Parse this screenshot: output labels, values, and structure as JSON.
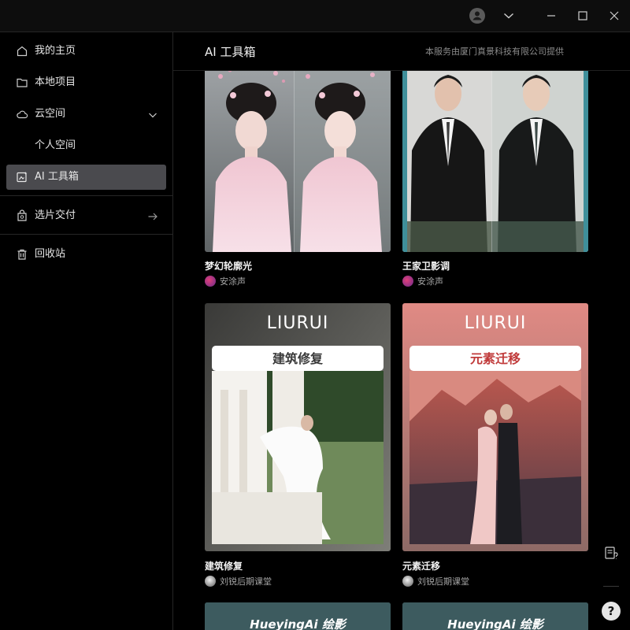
{
  "window": {
    "user_icon": "user-icon",
    "dropdown_icon": "chevron-down-icon",
    "minimize_icon": "minimize-icon",
    "maximize_icon": "maximize-icon",
    "close_icon": "close-icon"
  },
  "sidebar": {
    "items": [
      {
        "label": "我的主页",
        "icon": "home-icon"
      },
      {
        "label": "本地项目",
        "icon": "folder-icon"
      },
      {
        "label": "云空间",
        "icon": "cloud-icon"
      },
      {
        "label": "个人空间",
        "icon": ""
      },
      {
        "label": "AI 工具箱",
        "icon": "ai-toolbox-icon",
        "active": true
      },
      {
        "label": "选片交付",
        "icon": "delivery-icon"
      },
      {
        "label": "回收站",
        "icon": "trash-icon"
      }
    ]
  },
  "main": {
    "title": "AI 工具箱",
    "notice": "本服务由厦门真景科技有限公司提供",
    "cards": [
      {
        "title": "梦幻轮廓光",
        "author": "安涂声"
      },
      {
        "title": "王家卫影调",
        "author": "安涂声"
      },
      {
        "title": "建筑修复",
        "author": "刘锐后期课堂",
        "brand": "LIURUI",
        "banner": "建筑修复"
      },
      {
        "title": "元素迁移",
        "author": "刘锐后期课堂",
        "brand": "LIURUI",
        "banner": "元素迁移"
      },
      {
        "brand": "HueyingAi 绘影"
      },
      {
        "brand": "HueyingAi 绘影"
      }
    ]
  },
  "tools": {
    "feedback_icon": "feedback-icon",
    "help_label": "?"
  },
  "colors": {
    "background": "#000000",
    "active_item": "#4a4a4e",
    "divider": "#262626"
  }
}
